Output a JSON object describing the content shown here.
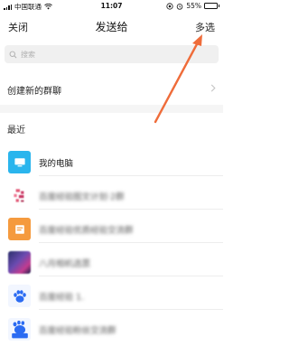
{
  "status_bar": {
    "carrier": "中国联通",
    "time": "11:07",
    "battery_percent": "55%",
    "battery_level": 0.55,
    "icons": [
      "signal-icon",
      "wifi-icon",
      "location-icon",
      "alarm-icon",
      "battery-icon"
    ]
  },
  "nav": {
    "close_label": "关闭",
    "title": "发送给",
    "multi_select_label": "多选"
  },
  "search": {
    "placeholder": "搜索"
  },
  "create_group": {
    "label": "创建新的群聊"
  },
  "recent": {
    "label": "最近",
    "contacts": [
      {
        "name": "我的电脑",
        "avatar": "computer-icon"
      },
      {
        "name": "百度经验图文计划·2群",
        "avatar": "pixel-avatar"
      },
      {
        "name": "百度经验优质经验交流群",
        "avatar": "document-avatar"
      },
      {
        "name": "八月相机选票",
        "avatar": "photo-avatar"
      },
      {
        "name": "百度经验 1.",
        "avatar": "baidu-paw-avatar"
      },
      {
        "name": "百度经验粉丝交流群",
        "avatar": "baidu-du-avatar"
      }
    ]
  },
  "colors": {
    "accent_arrow": "#ef6c3a",
    "computer_avatar": "#2ab5ed",
    "baidu_blue": "#2b6bf2",
    "divider": "#ededed"
  }
}
